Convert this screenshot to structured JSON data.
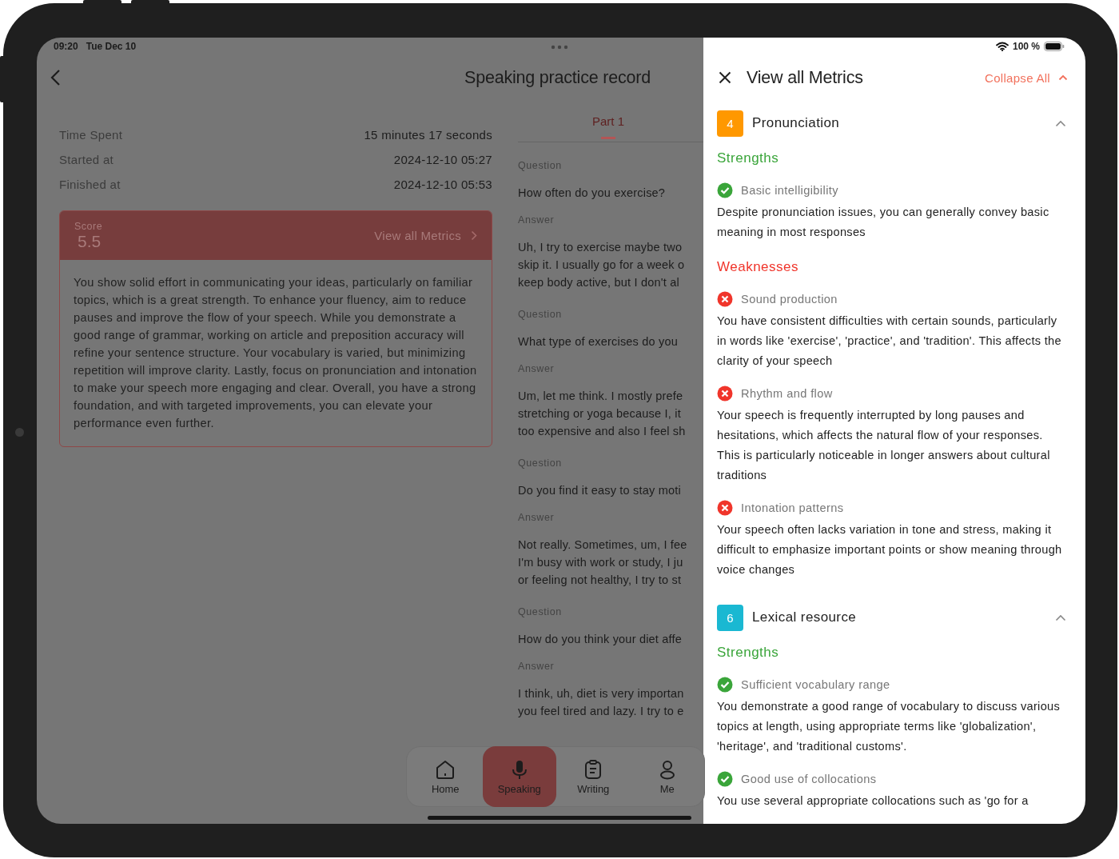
{
  "status_bar": {
    "time": "09:20",
    "date": "Tue Dec 10",
    "battery": "100 %"
  },
  "header": {
    "title": "Speaking practice record"
  },
  "summary": [
    {
      "label": "Time Spent",
      "value": "15 minutes 17 seconds"
    },
    {
      "label": "Started at",
      "value": "2024-12-10 05:27"
    },
    {
      "label": "Finished at",
      "value": "2024-12-10 05:53"
    }
  ],
  "score_card": {
    "label": "Score",
    "score": "5.5",
    "link": "View all Metrics",
    "feedback": "You show solid effort in communicating your ideas, particularly on familiar topics, which is a great strength. To enhance your fluency, aim to reduce pauses and improve the flow of your speech. While you demonstrate a good range of grammar, working on article and preposition accuracy will refine your sentence structure. Your vocabulary is varied, but minimizing repetition will improve clarity. Lastly, focus on pronunciation and intonation to make your speech more engaging and clear. Overall, you have a strong foundation, and with targeted improvements, you can elevate your performance even further."
  },
  "tabs": [
    {
      "label": "Part 1",
      "selected": true
    }
  ],
  "qa": [
    {
      "question_label": "Question",
      "question": "How often do you exercise?",
      "answer_label": "Answer",
      "answer_lines": [
        "Uh, I try to exercise maybe two",
        "skip it. I usually go for a week o",
        "keep body active, but I don't al"
      ]
    },
    {
      "question_label": "Question",
      "question": "What type of exercises do you",
      "answer_label": "Answer",
      "answer_lines": [
        "Um, let me think. I mostly prefe",
        "stretching or yoga because I, it",
        "too expensive and also I feel sh"
      ]
    },
    {
      "question_label": "Question",
      "question": "Do you find it easy to stay moti",
      "answer_label": "Answer",
      "answer_lines": [
        "Not really. Sometimes, um, I fee",
        "I'm busy with work or study, I ju",
        "or feeling not healthy, I try to st"
      ]
    },
    {
      "question_label": "Question",
      "question": "How do you think your diet affe",
      "answer_label": "Answer",
      "answer_lines": [
        "I think, uh, diet is very importan",
        "you feel tired and lazy. I try to e"
      ]
    }
  ],
  "bottom_nav": [
    {
      "kind": "home",
      "label": "Home",
      "selected": false
    },
    {
      "kind": "mic",
      "label": "Speaking",
      "selected": true
    },
    {
      "kind": "clipboard",
      "label": "Writing",
      "selected": false
    },
    {
      "kind": "person",
      "label": "Me",
      "selected": false
    }
  ],
  "metrics_panel": {
    "title": "View all Metrics",
    "collapse_all": "Collapse All",
    "sections": [
      {
        "score": "4",
        "color": "#ff9800",
        "title": "Pronunciation",
        "expanded": true,
        "groups": [
          {
            "kind": "strengths",
            "heading": "Strengths",
            "items": [
              {
                "title": "Basic intelligibility",
                "text": "Despite pronunciation issues, you can generally convey basic meaning in most responses"
              }
            ]
          },
          {
            "kind": "weaknesses",
            "heading": "Weaknesses",
            "items": [
              {
                "title": "Sound production",
                "text": "You have consistent difficulties with certain sounds, particularly in words like 'exercise', 'practice', and 'tradition'. This affects the clarity of your speech"
              },
              {
                "title": "Rhythm and flow",
                "text": "Your speech is frequently interrupted by long pauses and hesitations, which affects the natural flow of your responses. This is particularly noticeable in longer answers about cultural traditions"
              },
              {
                "title": "Intonation patterns",
                "text": "Your speech often lacks variation in tone and stress, making it difficult to emphasize important points or show meaning through voice changes"
              }
            ]
          }
        ]
      },
      {
        "score": "6",
        "color": "#1ab8d2",
        "title": "Lexical resource",
        "expanded": true,
        "groups": [
          {
            "kind": "strengths",
            "heading": "Strengths",
            "items": [
              {
                "title": "Sufficient vocabulary range",
                "text": "You demonstrate a good range of vocabulary to discuss various topics at length, using appropriate terms like 'globalization', 'heritage', and 'traditional customs'."
              },
              {
                "title": "Good use of collocations",
                "text": "You use several appropriate collocations such as 'go for a"
              }
            ]
          }
        ]
      }
    ]
  }
}
